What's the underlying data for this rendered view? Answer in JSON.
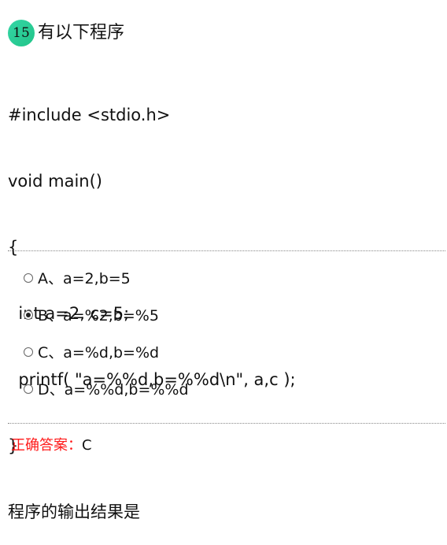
{
  "question": {
    "number": "15",
    "title": "有以下程序",
    "code_lines": [
      "#include <stdio.h>",
      "void main()",
      "{",
      "  int a=2, c=5;",
      "  printf( \"a=%%d,b=%%d\\n\", a,c );",
      "}"
    ],
    "prompt": "程序的输出结果是"
  },
  "options": [
    {
      "label": "A、a=2,b=5",
      "selected": false
    },
    {
      "label": "B、a=%2,b=%5",
      "selected": true
    },
    {
      "label": "C、a=%d,b=%d",
      "selected": false
    },
    {
      "label": "D、a=%%d,b=%%d",
      "selected": false
    }
  ],
  "answer": {
    "label": "正确答案：",
    "value": "C"
  },
  "colors": {
    "badge": "#21c488",
    "answer_label": "#ff1a1a"
  }
}
